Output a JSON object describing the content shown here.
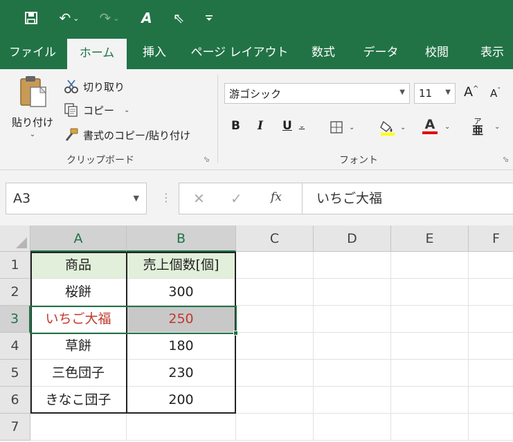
{
  "qat": {
    "save": "🖫",
    "undo": "↶",
    "redo": "↷",
    "font_a": "A",
    "pointer": "⇖",
    "customize": "⫷"
  },
  "tabs": [
    "ファイル",
    "ホーム",
    "挿入",
    "ページ レイアウト",
    "数式",
    "データ",
    "校閲",
    "表示"
  ],
  "ribbon": {
    "paste_label": "貼り付け",
    "cut_label": "切り取り",
    "copy_label": "コピー",
    "format_painter_label": "書式のコピー/貼り付け",
    "clipboard_group": "クリップボード",
    "font_name": "游ゴシック",
    "font_size": "11",
    "grow_font": "A",
    "shrink_font": "A",
    "bold": "B",
    "italic": "I",
    "underline": "U",
    "font_color_letter": "A",
    "phonetic_letter": "ア",
    "font_group": "フォント",
    "font_color": "#e00000"
  },
  "formula_bar": {
    "name_box": "A3",
    "cancel": "✕",
    "enter": "✓",
    "fx": "fx",
    "content": "いちご大福"
  },
  "sheet": {
    "columns": [
      "A",
      "B",
      "C",
      "D",
      "E",
      "F"
    ],
    "rows": [
      "1",
      "2",
      "3",
      "4",
      "5",
      "6",
      "7"
    ],
    "cells": [
      [
        "商品",
        "売上個数[個]"
      ],
      [
        "桜餅",
        "300"
      ],
      [
        "いちご大福",
        "250"
      ],
      [
        "草餅",
        "180"
      ],
      [
        "三色団子",
        "230"
      ],
      [
        "きなこ団子",
        "200"
      ]
    ],
    "active_cell": "A3"
  }
}
